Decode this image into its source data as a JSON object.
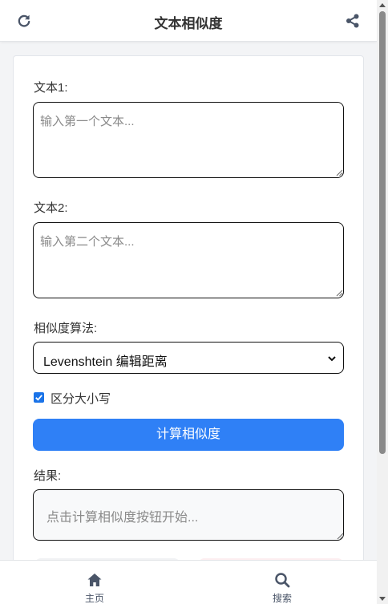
{
  "header": {
    "title": "文本相似度",
    "refresh_icon": "refresh-icon",
    "share_icon": "share-icon"
  },
  "form": {
    "text1": {
      "label": "文本1:",
      "value": "",
      "placeholder": "输入第一个文本..."
    },
    "text2": {
      "label": "文本2:",
      "value": "",
      "placeholder": "输入第二个文本..."
    },
    "algorithm": {
      "label": "相似度算法:",
      "selected": "Levenshtein 编辑距离"
    },
    "case_sensitive": {
      "label": "区分大小写",
      "checked": true
    },
    "calculate_label": "计算相似度",
    "result": {
      "label": "结果:",
      "placeholder": "点击计算相似度按钮开始..."
    }
  },
  "nav": {
    "items": [
      {
        "label": "主页",
        "icon": "home-icon"
      },
      {
        "label": "搜索",
        "icon": "search-icon"
      }
    ]
  },
  "colors": {
    "primary": "#2f80f6",
    "checkbox": "#1a73e8",
    "text": "#333333"
  }
}
